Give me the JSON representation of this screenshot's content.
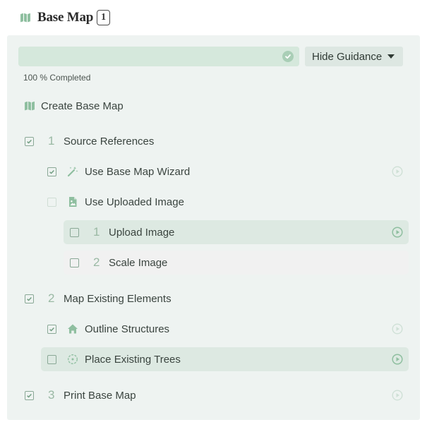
{
  "header": {
    "title": "Base Map",
    "badge": "1"
  },
  "progress": {
    "percent": 100,
    "completed_label": "100 % Completed"
  },
  "guidance": {
    "label": "Hide Guidance"
  },
  "section": {
    "title": "Create Base Map"
  },
  "steps": [
    {
      "number": "1",
      "label": "Source References",
      "checked": true
    },
    {
      "label": "Use Base Map Wizard",
      "checked": true,
      "icon": "magic-wand-icon"
    },
    {
      "label": "Use Uploaded Image",
      "checked": false,
      "icon": "image-file-icon"
    },
    {
      "number": "1",
      "label": "Upload Image",
      "checked": false
    },
    {
      "number": "2",
      "label": "Scale Image",
      "checked": false
    },
    {
      "number": "2",
      "label": "Map Existing Elements",
      "checked": true
    },
    {
      "label": "Outline Structures",
      "checked": true,
      "icon": "house-icon"
    },
    {
      "label": "Place Existing Trees",
      "checked": false,
      "icon": "tree-icon"
    },
    {
      "number": "3",
      "label": "Print Base Map",
      "checked": true
    }
  ],
  "colors": {
    "accent": "#8fbfa0",
    "panel_bg": "#eef3f1",
    "progress_fill": "#d5e8dc",
    "highlight_row": "#dde9e2"
  }
}
